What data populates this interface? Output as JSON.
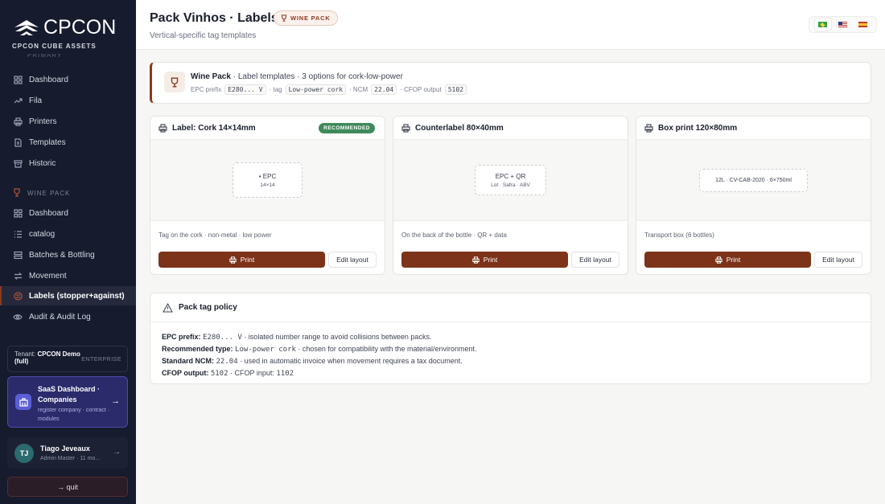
{
  "brand": {
    "name": "CPCON",
    "subtitle": "CPCON CUBE ASSETS",
    "cut_label": "PRIMARY"
  },
  "sidebar": {
    "items_top": [
      {
        "label": "Dashboard",
        "icon": "grid-icon"
      },
      {
        "label": "Fila",
        "icon": "trend-icon"
      },
      {
        "label": "Printers",
        "icon": "printer-icon"
      },
      {
        "label": "Templates",
        "icon": "file-icon"
      },
      {
        "label": "Historic",
        "icon": "archive-icon"
      }
    ],
    "section_label": "WINE PACK",
    "items_wine": [
      {
        "label": "Dashboard",
        "icon": "grid-icon"
      },
      {
        "label": "catalog",
        "icon": "list-icon"
      },
      {
        "label": "Batches & Bottling",
        "icon": "layers-icon"
      },
      {
        "label": "Movement",
        "icon": "swap-icon"
      },
      {
        "label": "Labels (stopper+against)",
        "icon": "tag-icon"
      },
      {
        "label": "Audit & Audit Log",
        "icon": "eye-icon"
      }
    ],
    "tenant": {
      "prefix": "Tenant:",
      "name": "CPCON Demo",
      "suffix": "(full)",
      "plan": "ENTERPRISE"
    },
    "saas": {
      "title": "SaaS Dashboard · Companies",
      "subtitle": "register company · contract · modules",
      "arrow": "→"
    },
    "user": {
      "initials": "TJ",
      "name": "Tiago Jeveaux",
      "role": "Admin Master · 11 mo...",
      "arrow": "→"
    },
    "quit_label": "→ quit"
  },
  "header": {
    "title": "Pack Vinhos · Labels",
    "badge": "WINE PACK",
    "subtitle": "Vertical-specific tag templates"
  },
  "info": {
    "title": "Wine Pack",
    "text": " · Label templates · 3 options for cork-low-power",
    "epc_label": "EPC prefix",
    "epc_value": "E280... V",
    "tag_label": "· tag",
    "tag_value": "Low-power cork",
    "ncm_label": "· NCM",
    "ncm_value": "22.04",
    "cfop_label": "· CFOP output",
    "cfop_value": "5102"
  },
  "cards": [
    {
      "title": "Label: Cork 14×14mm",
      "badge": "RECOMMENDED",
      "tag_line1": "• EPC",
      "tag_line2": "14×14",
      "desc": "Tag on the cork · non-metal · low power",
      "print": "Print",
      "edit": "Edit layout"
    },
    {
      "title": "Counterlabel 80×40mm",
      "tag_line1": "EPC + QR",
      "tag_line2": "Lot · Safra · ABV",
      "desc": "On the back of the bottle · QR + data",
      "print": "Print",
      "edit": "Edit layout"
    },
    {
      "title": "Box print 120×80mm",
      "tag_line1": "12L · CV-CAB-2020 · 6×750ml",
      "desc": "Transport box (6 bottles)",
      "print": "Print",
      "edit": "Edit layout"
    }
  ],
  "policy": {
    "title": "Pack tag policy",
    "lines": [
      {
        "label": "EPC prefix:",
        "code": "E280... V",
        "text": " · isolated number range to avoid collisions between packs."
      },
      {
        "label": "Recommended type:",
        "code": "Low-power cork",
        "text": " · chosen for compatibility with the material/environment."
      },
      {
        "label": "Standard NCM:",
        "code": "22.04",
        "text": " · used in automatic invoice when movement requires a tax document."
      },
      {
        "label": "CFOP output:",
        "code": "5102",
        "text": " · CFOP input: ",
        "code2": "1102"
      }
    ]
  },
  "colors": {
    "accent": "#7d3319",
    "sidebar_bg": "#161b2e",
    "recommended": "#3f8a5a"
  }
}
